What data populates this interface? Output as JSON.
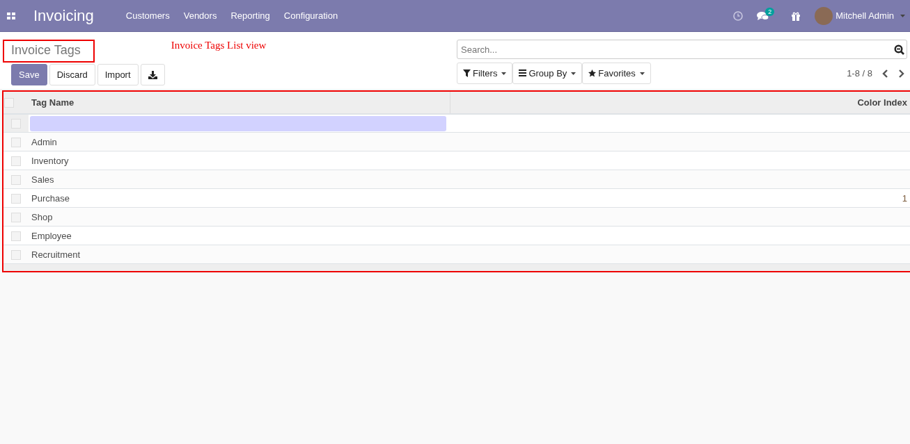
{
  "navbar": {
    "app_title": "Invoicing",
    "menu": [
      "Customers",
      "Vendors",
      "Reporting",
      "Configuration"
    ],
    "messages_badge": "2",
    "user": "Mitchell Admin"
  },
  "control_panel": {
    "breadcrumb": "Invoice Tags",
    "annotation": "Invoice Tags List view",
    "buttons": [
      "Save",
      "Discard",
      "Import"
    ],
    "search": {
      "placeholder": "Search..."
    },
    "filters": [
      "Filters",
      "Group By",
      "Favorites"
    ],
    "pager": "1-8 / 8"
  },
  "table": {
    "columns": [
      "Tag Name",
      "Color Index"
    ],
    "all_checked": false,
    "new_row": {
      "checked": false
    },
    "rows": [
      {
        "name": "Admin",
        "checked": false
      },
      {
        "name": "Inventory",
        "checked": false
      },
      {
        "name": "Sales",
        "checked": false
      },
      {
        "name": "Purchase",
        "color_index": "1",
        "checked": false
      },
      {
        "name": "Shop",
        "checked": false
      },
      {
        "name": "Employee",
        "checked": false
      },
      {
        "name": "Recruitment",
        "checked": false
      }
    ]
  }
}
